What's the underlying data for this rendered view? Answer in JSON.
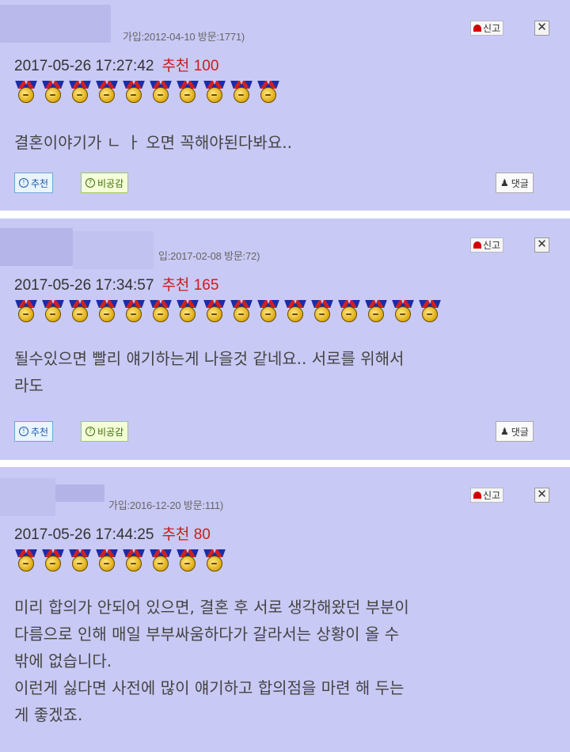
{
  "report_label": "신고",
  "close_label": "✕",
  "buttons": {
    "recommend": "추천",
    "not_agree": "비공감",
    "reply": "댓글"
  },
  "comments": [
    {
      "join_info": "가입:2012-04-10 방문:1771)",
      "datetime": "2017-05-26 17:27:42",
      "rec_label": "추천",
      "rec_count": "100",
      "medal_count": 10,
      "body": "결혼이야기가 ㄴ ㅏ 오면 꼭해야된다봐요.."
    },
    {
      "join_info": "입:2017-02-08 방문:72)",
      "datetime": "2017-05-26 17:34:57",
      "rec_label": "추천",
      "rec_count": "165",
      "medal_count": 16,
      "body": "될수있으면 빨리 얘기하는게 나을것 같네요.. 서로를 위해서\n라도"
    },
    {
      "join_info": "가입:2016-12-20 방문:111)",
      "datetime": "2017-05-26 17:44:25",
      "rec_label": "추천",
      "rec_count": "80",
      "medal_count": 8,
      "body": "미리 합의가 안되어 있으면, 결혼 후 서로 생각해왔던 부분이\n다름으로 인해 매일 부부싸움하다가 갈라서는 상황이 올 수\n밖에 없습니다.\n이런게 싫다면 사전에 많이 얘기하고 합의점을 마련 해 두는\n게 좋겠죠."
    }
  ],
  "colors": {
    "comment_bg": "#c9c9f5",
    "rec_red": "#c81e1e"
  }
}
